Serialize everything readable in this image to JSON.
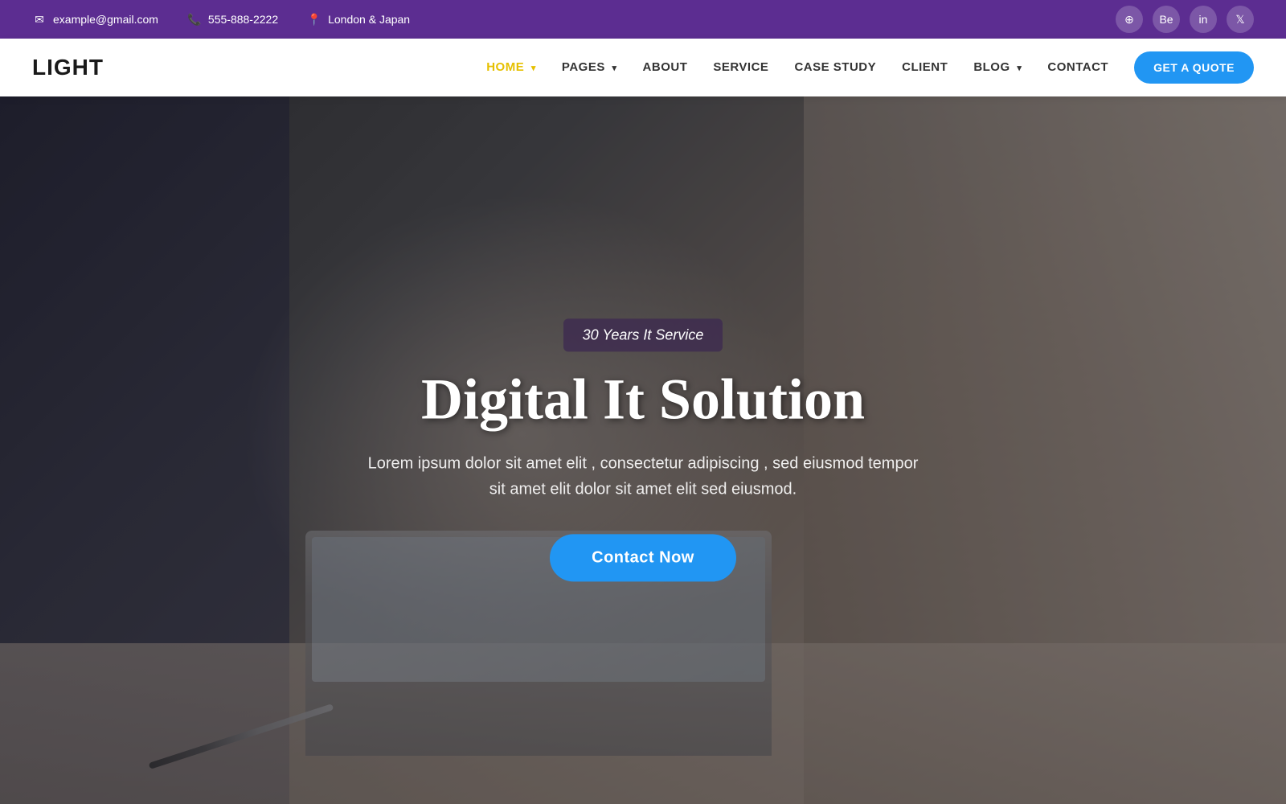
{
  "topbar": {
    "email": "example@gmail.com",
    "phone": "555-888-2222",
    "location": "London & Japan"
  },
  "social": {
    "icons": [
      "globe",
      "behance",
      "linkedin",
      "twitter"
    ]
  },
  "navbar": {
    "logo": "LIGHT",
    "links": [
      {
        "label": "HOME",
        "active": true,
        "has_dropdown": true
      },
      {
        "label": "PAGES",
        "active": false,
        "has_dropdown": true
      },
      {
        "label": "ABOUT",
        "active": false,
        "has_dropdown": false
      },
      {
        "label": "SERVICE",
        "active": false,
        "has_dropdown": false
      },
      {
        "label": "CASE STUDY",
        "active": false,
        "has_dropdown": false
      },
      {
        "label": "CLIENT",
        "active": false,
        "has_dropdown": false
      },
      {
        "label": "BLOG",
        "active": false,
        "has_dropdown": true
      },
      {
        "label": "CONTACT",
        "active": false,
        "has_dropdown": false
      }
    ],
    "cta_label": "GET A QUOTE"
  },
  "hero": {
    "badge": "30 Years It Service",
    "title": "Digital It Solution",
    "subtitle": "Lorem ipsum dolor sit amet elit , consectetur adipiscing , sed eiusmod tempor\nsit amet elit dolor sit amet elit sed eiusmod.",
    "cta_label": "Contact Now"
  }
}
